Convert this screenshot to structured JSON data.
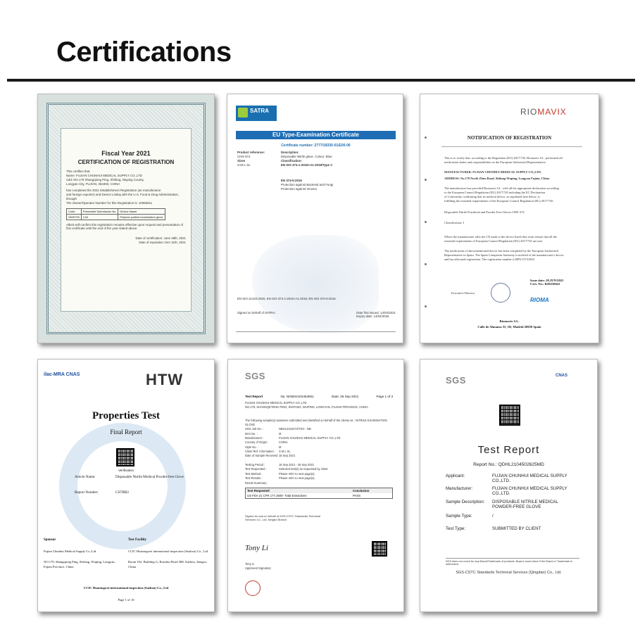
{
  "header": {
    "title": "Certifications"
  },
  "cert1": {
    "fiscal_year": "Fiscal Year 2021",
    "heading": "CERTIFICATION OF REGISTRATION",
    "lines": [
      "This certifies that:",
      "Name: FUJIAN CHUNHUI MEDICAL SUPPLY CO.,LTD",
      "Add: NO.179 Shangqiong Ping, Shifang, Wuping County,",
      "Longyan City, FUJIAN, 364303, CHINA",
      "has completed the 2021 Establishment Registration (as manufacturer",
      "and foreign exporter) and Device Listing with the U.S. Food & Drug Administration,",
      "through",
      "The Owner/Operator Number for this Registration is: 10082811"
    ],
    "table": [
      [
        "Code",
        "Premarket Submission No.",
        "Device Name"
      ],
      [
        "OMS793",
        "LZA",
        "Polymer patient examination glove"
      ]
    ],
    "note": "Albeit self-confirm this registration remains effective upon request and presentation of this certificate until the end of the year stated above.",
    "dates": [
      "Date of certification: June 28th, 2021",
      "Date of expiration: Dec 31th, 2021"
    ]
  },
  "cert2": {
    "logo": "SATRA",
    "title": "EU Type-Examination Certificate",
    "number": "Certificate number: 2777/18330-01/E00-06",
    "rows": [
      [
        "Product reference:",
        "Description:"
      ],
      [
        "CHN-374",
        "Disposable Nitrile glove. Colour: Blue."
      ],
      [
        "Sizes",
        "Classification:"
      ],
      [
        "S-M-L-XL",
        "EN ISO 374-1:2016+A1:2018/Type C"
      ],
      [
        "",
        "EN 374-5:2016"
      ],
      [
        "",
        "Protection against Bacterial and Fungi"
      ],
      [
        "",
        "Protection against Viruses"
      ]
    ],
    "standards": "EN ISO 21420:2020, EN ISO 374-1:2016+A1:2018, EN ISO 374-5:2016",
    "signed": "Signed on behalf of SATRA:",
    "date_issued": "Date first issued: 14/04/2021",
    "date_expiry": "Expiry date: 14/04/2026"
  },
  "cert3": {
    "brand_a": "RIO",
    "brand_b": "MAVIX",
    "title": "NOTIFICATION OF REGISTRATION",
    "lines": [
      "This is to certify that, according to the Regulation (EU) 2017/745, Riomavix S.L. performed all",
      "notification duties and responsibilities as the European Authorized Representative.",
      "MANUFACTURER: FUJIAN CHUNHUI MEDICAL SUPPLY CO.,LTD.",
      "ADDRESS: No.179 North Zhuo Road, Shifang Wuping, Longyan Fujian, China",
      "The manufacturer has provided Riomavix S.L. with all the appropriate declaration according",
      "to the European Council Regulation (EU) 2017/745 including the EC Declaration",
      "of Conformity confirming that its medical device, as stipulated here below, is",
      "fulfilling the essential requirements of the European Council Regulation (EU) 2017/745.",
      "Disposable Nitrile Powdered and Powder Free Gloves CHN-374",
      "Classification: I",
      "Where the manufacturer affix the CE mark to the device listed they must ensure that all the",
      "essential requirements of European Council Regulation (EU) 2017/745 are met.",
      "The notification of abovementioned device has been completed by the European Authorized",
      "Representative in Spain. The Spain Competent Authority is notified of the manufacturer's device",
      "and has allocated registration. The registration number is RPS/1573/2021"
    ],
    "issue_date": "Issue date: 28.JUN/2021",
    "cert_no": "Cert. No.: R20210622",
    "exec": "Executive Director",
    "rioma": "RIOMA",
    "addr1": "Riomavix S.L.",
    "addr2": "Calle de Almansa 55, 1D, Madrid 28039 Spain"
  },
  "cert4": {
    "logos": "ilac-MRA  CNAS",
    "htw": "HTW",
    "title": "Properties Test",
    "subtitle": "Final Report",
    "verify": "Verification",
    "article_label": "Article Name:",
    "article_value": "Disposable Nitrile Medical Powder-free Glove",
    "report_label": "Report Number:",
    "report_value": "CSTBB2",
    "sponsor_label": "Sponsor",
    "facility_label": "Test Facility",
    "sponsor": [
      "Fujian Chunhui Medical Supply Co.,Ltd",
      "NO.179, Shangqiong Ping, Shifang, Wuping, Longyan, Fujian Province, China"
    ],
    "facility": [
      "CCIC Huatongwei international inspection (Suzhou) Co., Ltd",
      "Room 102, Building G, Ruoshui Road 388, Suzhou, Jiangsu, China"
    ],
    "footer": "CCIC Huatongwei international inspection (Suzhou) Co., Ltd",
    "page": "Page 1 of 10"
  },
  "cert5": {
    "logo": "SGS",
    "report": "Test Report",
    "no": "No. NGBH2104454601",
    "date": "Date: 26 Sep 2021",
    "page": "Page 1 of 3",
    "rows": [
      [
        "",
        "FUJIAN CHUNHUI MEDICAL SUPPLY CO.,LTD"
      ],
      [
        "",
        "NO.179, SHANGQETENG PING, SHIFANG, WUPING, LONGYAN, FUJIAN PROVINCE, CHINA"
      ],
      [
        "",
        "The following sample(s) was/were submitted and identified on behalf of the clients as : NITRILE EXAMINATION GLOVE"
      ],
      [
        "SGS Job No. :",
        "NBHL2104473/TSO - NB"
      ],
      [
        "Item No. :",
        "M"
      ],
      [
        "Manufacturer :",
        "FUJIAN CHUNHUI MEDICAL SUPPLY CO.,LTD"
      ],
      [
        "Country of Origin :",
        "CHINA"
      ],
      [
        "Style No. :",
        "M"
      ],
      [
        "Client Ref. Information :",
        "S M L XL"
      ],
      [
        "Date of Sample Received :",
        "18 Sep 2021"
      ],
      [
        "Testing Period :",
        "18 Sep 2021 - 26 Sep 2021"
      ],
      [
        "Test Requested :",
        "Selected test(s) as requested by client."
      ],
      [
        "Test Method :",
        "Please refer to next page(s)."
      ],
      [
        "Test Results :",
        "Please refer to next page(s)."
      ],
      [
        "Result Summary :",
        ""
      ]
    ],
    "tbl_head": [
      "Test Requested",
      "Conclusion"
    ],
    "tbl_row": [
      "US FDA 21 CFR 177.2600- Total Extractives",
      "PASS"
    ],
    "signed": "Signed for and on behalf of SGS-CSTC Standards Technical Services Co., Ltd. Ningbo Branch",
    "signature": "Tony Li",
    "sig_name": "Tony Li",
    "sig_title": "Approved Signatory"
  },
  "cert6": {
    "logo": "SGS",
    "cnas": "CNAS",
    "title": "Test Report",
    "report_no": "Report No.: QDHL2104502625MD",
    "fields": [
      {
        "k": "Applicant:",
        "v": "FUJIAN CHUNHUI MEDICAL SUPPLY CO.,LTD."
      },
      {
        "k": "Manufacturer:",
        "v": "FUJIAN CHUNHUI MEDICAL SUPPLY CO.,LTD."
      },
      {
        "k": "Sample Description:",
        "v": "DISPOSABLE NITRILE MEDICAL POWDER-FREE GLOVE"
      },
      {
        "k": "Sample Type:",
        "v": "/"
      },
      {
        "k": "Test Type:",
        "v": "SUBMITTED BY CLIENT"
      }
    ],
    "disclaimer": "SGS does not vouch for any Brand/Trademark of products. Buyers must check if the Brand or Trademark is authorized.",
    "lab": "SGS-CSTC Standards Technical Services (Qingdao) Co., Ltd."
  }
}
